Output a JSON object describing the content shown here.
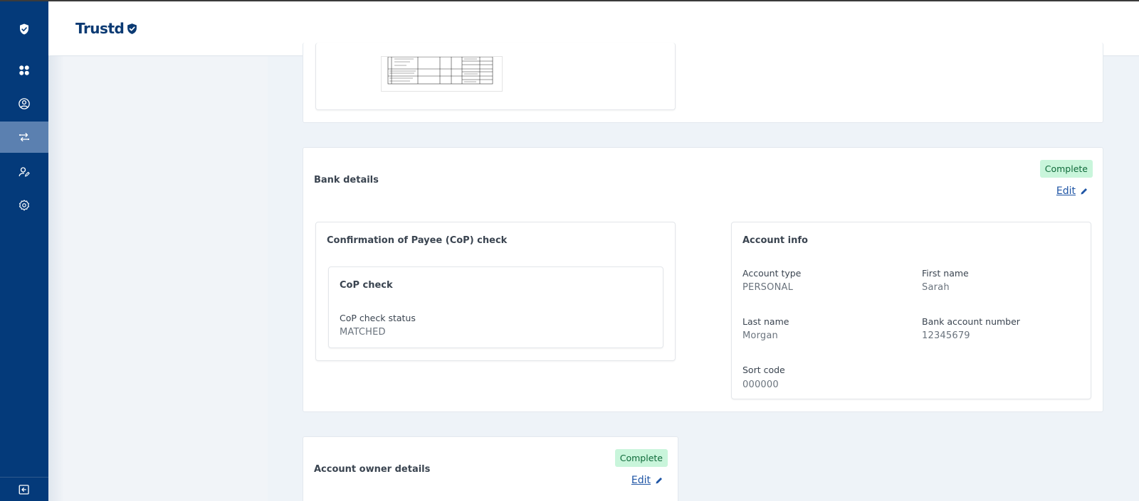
{
  "app": {
    "brand": "Trustd"
  },
  "sidebar": {
    "items": [
      {
        "icon": "shield-check-icon",
        "active": false
      },
      {
        "icon": "dashboard-icon",
        "active": false
      },
      {
        "icon": "user-circle-icon",
        "active": false
      },
      {
        "icon": "transfer-icon",
        "active": true
      },
      {
        "icon": "user-edit-icon",
        "active": false
      },
      {
        "icon": "settings-icon",
        "active": false
      }
    ],
    "logout_icon": "logout-icon"
  },
  "bank_details": {
    "title": "Bank details",
    "status": "Complete",
    "edit_label": "Edit",
    "cop": {
      "title": "Confirmation of Payee (CoP) check",
      "check_title": "CoP check",
      "status_label": "CoP check status",
      "status_value": "MATCHED"
    },
    "account_info": {
      "title": "Account info",
      "account_type_label": "Account type",
      "account_type_value": "PERSONAL",
      "first_name_label": "First name",
      "first_name_value": "Sarah",
      "last_name_label": "Last name",
      "last_name_value": "Morgan",
      "bank_account_number_label": "Bank account number",
      "bank_account_number_value": "12345679",
      "sort_code_label": "Sort code",
      "sort_code_value": "000000"
    }
  },
  "account_owner": {
    "title": "Account owner details",
    "status": "Complete",
    "edit_label": "Edit"
  },
  "colors": {
    "sidebar": "#043a7a",
    "sidebar_active": "#5b80b0",
    "badge_bg": "#c9f5db",
    "badge_text": "#0f6b3a",
    "link": "#1f55a5"
  }
}
